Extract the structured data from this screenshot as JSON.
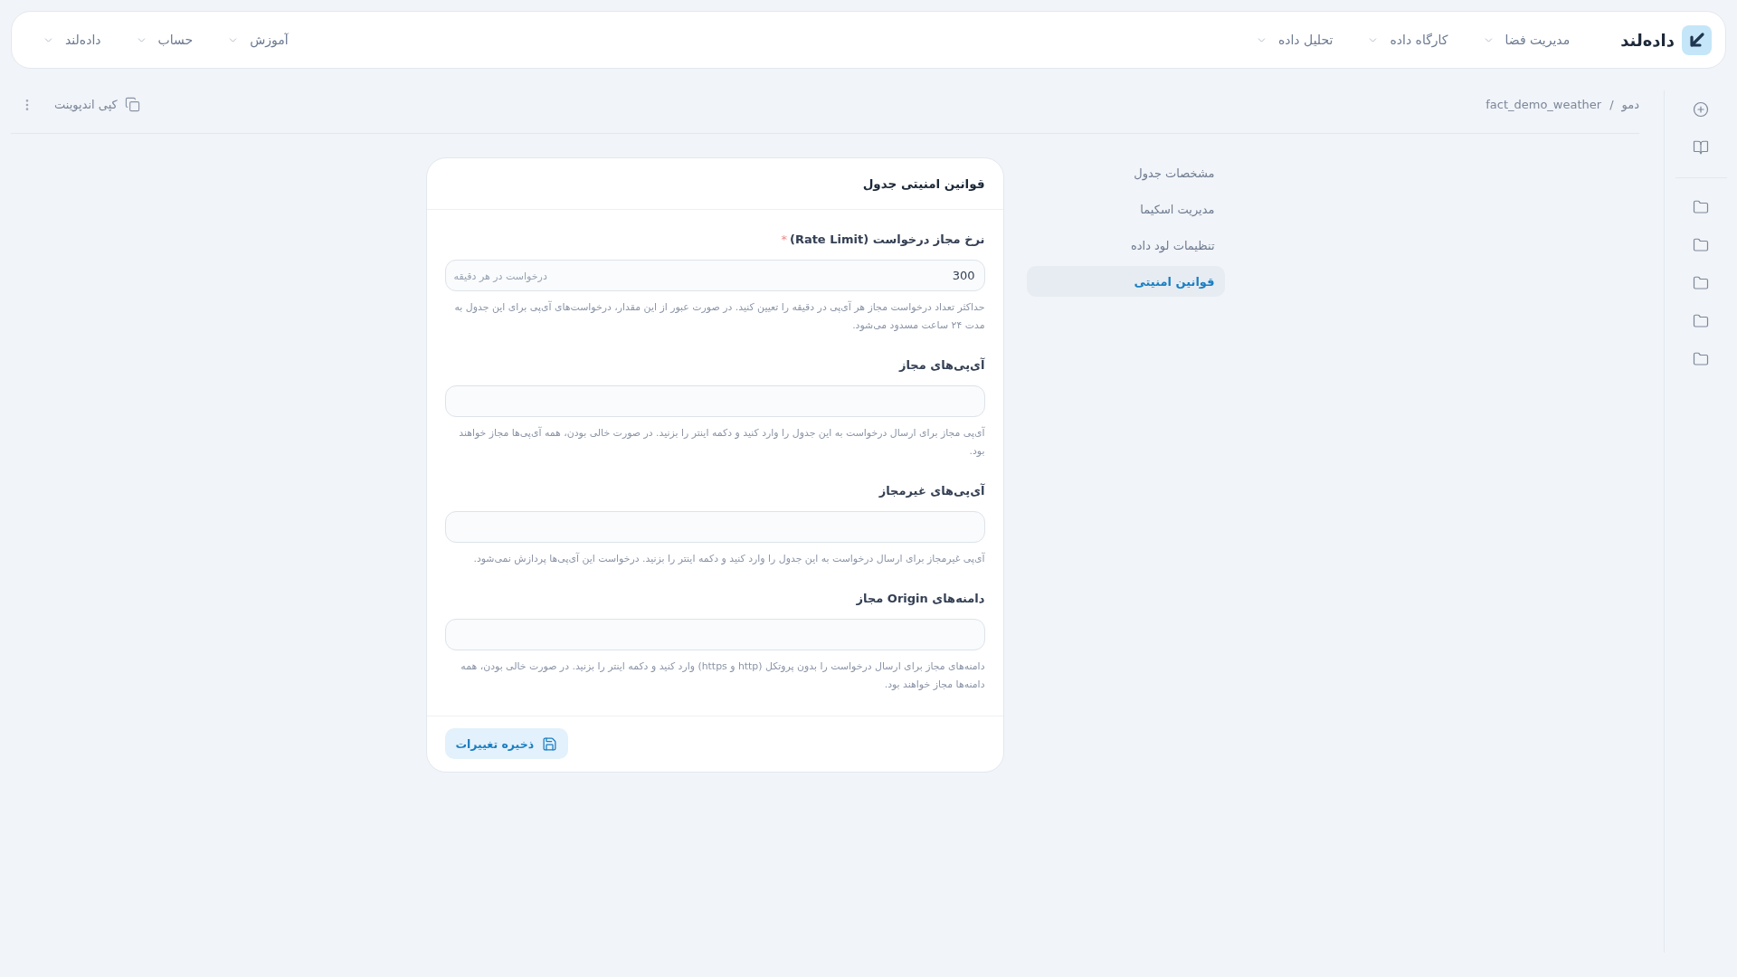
{
  "top_bar": {
    "logo": {
      "text": "داده‌لند"
    },
    "nav_main": [
      {
        "label": "مدیریت فضا"
      },
      {
        "label": "کارگاه داده"
      },
      {
        "label": "تحلیل داده"
      }
    ],
    "nav_secondary": [
      {
        "label": "آموزش"
      },
      {
        "label": "حساب"
      },
      {
        "label": "داده‌لند"
      }
    ]
  },
  "breadcrumb": {
    "items": [
      "دمو",
      "fact_demo_weather"
    ],
    "separator": "/"
  },
  "toolbar": {
    "copy_endpoint": "کپی اندپوینت"
  },
  "side_menu": [
    {
      "label": "مشخصات جدول",
      "selected": false
    },
    {
      "label": "مدیریت اسکیما",
      "selected": false
    },
    {
      "label": "تنظیمات لود داده",
      "selected": false
    },
    {
      "label": "قوانین امنیتی",
      "selected": true
    }
  ],
  "card": {
    "title": "قوانین امنیتی جدول",
    "fields": [
      {
        "label": "نرخ مجاز درخواست (Rate Limit)",
        "required_mark": "*",
        "value": "300",
        "unit": "درخواست در هر دقیقه",
        "help": "حداکثر تعداد درخواست مجاز هر آی‌پی در دقیقه را تعیین کنید. در صورت عبور از این مقدار، درخواست‌های آی‌پی برای این جدول به مدت ۲۴ ساعت مسدود می‌شود."
      },
      {
        "label": "آی‌پی‌های مجاز",
        "help": "آی‌پی مجاز برای ارسال درخواست به این جدول را وارد کنید و دکمه اینتر را بزنید. در صورت خالی بودن، همه آی‌پی‌ها مجاز خواهند بود."
      },
      {
        "label": "آی‌پی‌های غیرمجاز",
        "help": "آی‌پی غیرمجاز برای ارسال درخواست به این جدول را وارد کنید و دکمه اینتر را بزنید. درخواست این آی‌پی‌ها پردازش نمی‌شود."
      },
      {
        "label": "دامنه‌های Origin مجاز",
        "help": "دامنه‌های مجاز برای ارسال درخواست را بدون پروتکل (http و https) وارد کنید و دکمه اینتر را بزنید. در صورت خالی بودن، همه دامنه‌ها مجاز خواهند بود."
      }
    ],
    "save_button": "ذخیره تغییرات"
  }
}
